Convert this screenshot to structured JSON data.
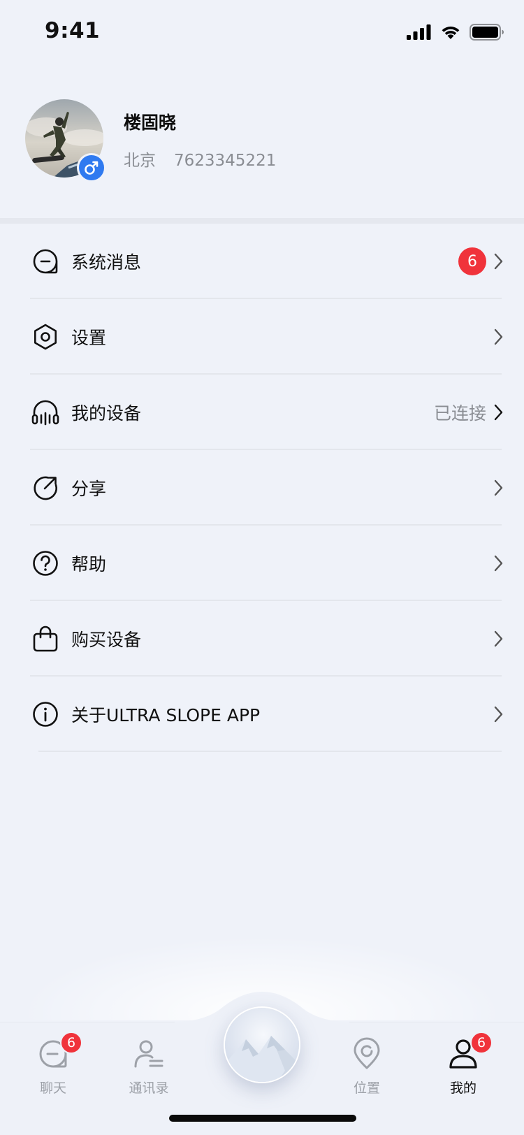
{
  "status_bar": {
    "time": "9:41"
  },
  "profile": {
    "name": "楼固晓",
    "city": "北京",
    "id_number": "7623345221",
    "gender_icon": "male-icon",
    "avatar": "snowboarder-photo"
  },
  "menu": {
    "items": [
      {
        "label": "系统消息",
        "icon": "message-icon",
        "badge": "6",
        "value": ""
      },
      {
        "label": "设置",
        "icon": "settings-hexagon-icon",
        "badge": "",
        "value": ""
      },
      {
        "label": "我的设备",
        "icon": "headphones-icon",
        "badge": "",
        "value": "已连接"
      },
      {
        "label": "分享",
        "icon": "share-icon",
        "badge": "",
        "value": ""
      },
      {
        "label": "帮助",
        "icon": "help-icon",
        "badge": "",
        "value": ""
      },
      {
        "label": "购买设备",
        "icon": "shopping-bag-icon",
        "badge": "",
        "value": ""
      },
      {
        "label": "关于ULTRA SLOPE APP",
        "icon": "info-icon",
        "badge": "",
        "value": ""
      }
    ]
  },
  "tabbar": {
    "tabs": [
      {
        "label": "聊天",
        "icon": "chat-icon",
        "badge": "6",
        "active": false
      },
      {
        "label": "通讯录",
        "icon": "contacts-icon",
        "badge": "",
        "active": false
      },
      {
        "label": "位置",
        "icon": "location-icon",
        "badge": "",
        "active": false
      },
      {
        "label": "我的",
        "icon": "profile-icon",
        "badge": "6",
        "active": true
      }
    ],
    "center_icon": "mountain-icon"
  },
  "colors": {
    "background": "#eff2f9",
    "badge_red": "#f0333b",
    "accent_blue": "#2f7af0",
    "muted_text": "#8a8d93"
  }
}
